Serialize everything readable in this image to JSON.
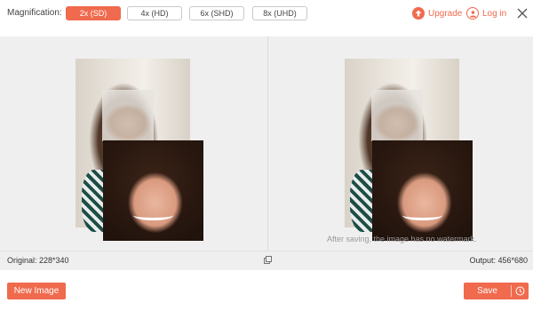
{
  "toolbar": {
    "magnification_label": "Magnification:",
    "options": [
      "2x (SD)",
      "4x (HD)",
      "6x (SHD)",
      "8x (UHD)"
    ],
    "selected_option": "2x (SD)",
    "upgrade_label": "Upgrade",
    "login_label": "Log in"
  },
  "preview": {
    "watermark_text": "After saving, the image has no watermark."
  },
  "info": {
    "original": "Original: 228*340",
    "output": "Output: 456*680"
  },
  "actions": {
    "new_image_label": "New Image",
    "save_label": "Save"
  },
  "colors": {
    "accent": "#f06a4d",
    "pane_bg": "#efefef"
  },
  "icons": [
    "upgrade-icon",
    "user-icon",
    "close-icon",
    "compare-icon",
    "clock-icon"
  ]
}
